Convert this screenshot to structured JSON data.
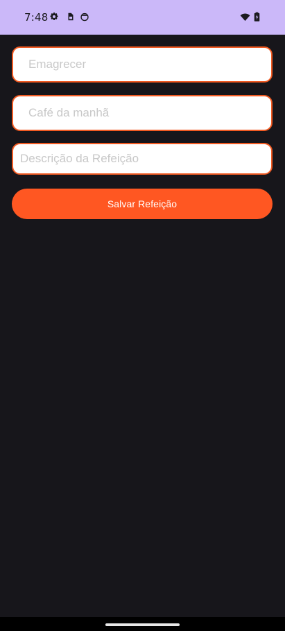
{
  "status_bar": {
    "time": "7:48",
    "left_icons": [
      "gear-icon",
      "sim-card-icon",
      "notification-face-icon"
    ],
    "right_icons": [
      "wifi-icon",
      "battery-icon"
    ],
    "background": "#cbb8f9"
  },
  "form": {
    "goal_placeholder": "Emagrecer",
    "meal_placeholder": "Café da manhã",
    "description_placeholder": "Descrição da Refeição",
    "goal_value": "",
    "meal_value": "",
    "description_value": ""
  },
  "actions": {
    "save_label": "Salvar Refeição"
  },
  "colors": {
    "accent": "#ff5722",
    "field_border": "#f15a22",
    "background": "#17161b"
  }
}
